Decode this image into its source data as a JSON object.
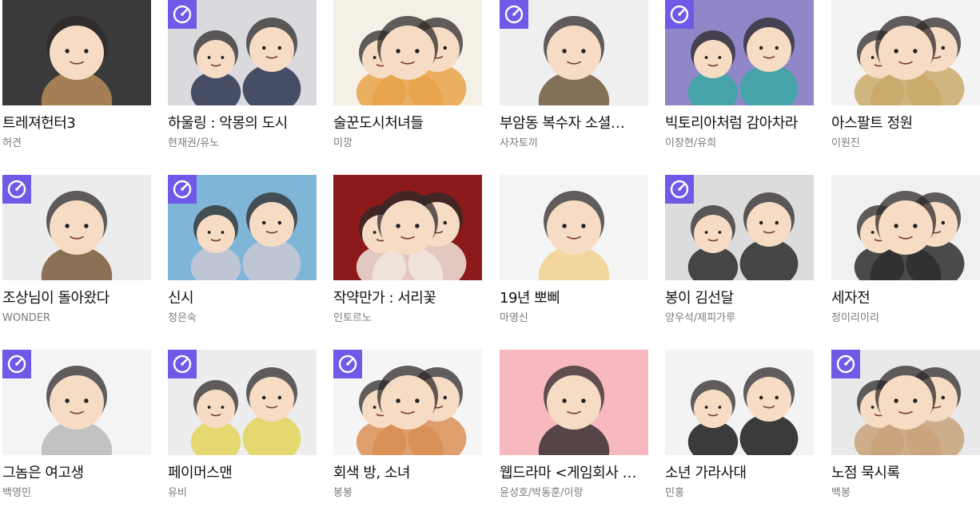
{
  "badge_icon": "speedometer-icon",
  "accent_color": "#6e5ae6",
  "cards": [
    {
      "title": "트레져헌터3",
      "author": "허견",
      "badge": false,
      "bg": "#3a3a3a",
      "fg": "#b78c5c"
    },
    {
      "title": "하울링 : 악몽의 도시",
      "author": "현재권/유노",
      "badge": true,
      "bg": "#d9d9de",
      "fg": "#2b3550"
    },
    {
      "title": "술꾼도시처녀들",
      "author": "미깡",
      "badge": false,
      "bg": "#f5f0e6",
      "fg": "#e9a34a"
    },
    {
      "title": "부암동 복수자 소셜…",
      "author": "사자토끼",
      "badge": true,
      "bg": "#efefef",
      "fg": "#6e5a3c"
    },
    {
      "title": "빅토리아처럼 감아차라",
      "author": "이창현/유희",
      "badge": true,
      "bg": "#8f87c7",
      "fg": "#3aa9a3"
    },
    {
      "title": "아스팔트 정원",
      "author": "이원진",
      "badge": false,
      "bg": "#f3f3f3",
      "fg": "#c9a96a"
    },
    {
      "title": "조상님이 돌아왔다",
      "author": "WONDER",
      "badge": true,
      "bg": "#ececec",
      "fg": "#7a5a3a"
    },
    {
      "title": "신시",
      "author": "정은숙",
      "badge": true,
      "bg": "#7fb6d8",
      "fg": "#c9c9d6"
    },
    {
      "title": "작약만가 : 서리꽃",
      "author": "인토르노",
      "badge": false,
      "bg": "#8c1a1a",
      "fg": "#f1e8df"
    },
    {
      "title": "19년 뽀삐",
      "author": "마영신",
      "badge": false,
      "bg": "#f4f4f4",
      "fg": "#f2cf8e"
    },
    {
      "title": "봉이 김선달",
      "author": "양우석/제피가루",
      "badge": true,
      "bg": "#dcdcdc",
      "fg": "#2a2a2a"
    },
    {
      "title": "세자전",
      "author": "정이리이리",
      "badge": false,
      "bg": "#f0f0f0",
      "fg": "#2d2d2d"
    },
    {
      "title": "그놈은 여고생",
      "author": "백영민",
      "badge": true,
      "bg": "#f4f4f4",
      "fg": "#b9b9b9"
    },
    {
      "title": "페이머스맨",
      "author": "유비",
      "badge": true,
      "bg": "#ededed",
      "fg": "#e3d45a"
    },
    {
      "title": "회색 방, 소녀",
      "author": "봉봉",
      "badge": true,
      "bg": "#f5f5f5",
      "fg": "#d98e55"
    },
    {
      "title": "웹드라마 <게임회사 …",
      "author": "윤성호/박동훈/이랑",
      "badge": false,
      "bg": "#f7b8c0",
      "fg": "#3a3030"
    },
    {
      "title": "소년 가라사대",
      "author": "민홍",
      "badge": false,
      "bg": "#f3f3f3",
      "fg": "#1a1a1a"
    },
    {
      "title": "노점 묵시록",
      "author": "백봉",
      "badge": true,
      "bg": "#e9e9e9",
      "fg": "#c9a27a"
    }
  ]
}
